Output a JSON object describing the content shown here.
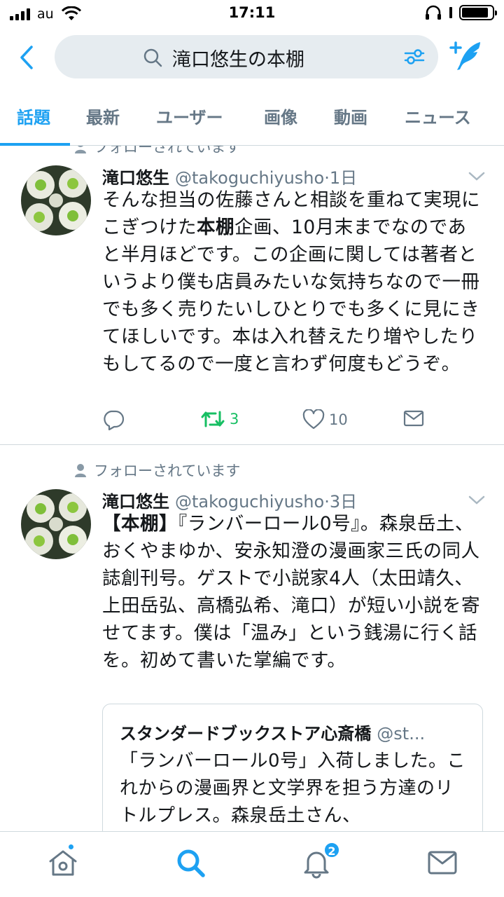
{
  "status_bar": {
    "carrier": "au",
    "time": "17:11"
  },
  "search": {
    "query": "滝口悠生の本棚"
  },
  "tabs": [
    {
      "label": "話題",
      "active": true
    },
    {
      "label": "最新",
      "active": false
    },
    {
      "label": "ユーザー",
      "active": false
    },
    {
      "label": "画像",
      "active": false
    },
    {
      "label": "動画",
      "active": false
    },
    {
      "label": "ニュース",
      "active": false
    }
  ],
  "tweets": [
    {
      "context": "フォローされています",
      "name": "滝口悠生",
      "handle": "@takoguchiyusho",
      "separator": "·",
      "age": "1日",
      "body_before": "そんな担当の佐藤さんと相談を重ねて実現にこぎつけた",
      "body_bold": "本棚",
      "body_after": "企画、10月末までなのであと半月ほどです。この企画に関しては著者というより僕も店員みたいな気持ちなので一冊でも多く売りたいしひとりでも多くに見にきてほしいです。本は入れ替えたり増やしたりもしてるので一度と言わず何度もどうぞ。",
      "retweets": "3",
      "likes": "10"
    },
    {
      "context": "フォローされています",
      "name": "滝口悠生",
      "handle": "@takoguchiyusho",
      "separator": "·",
      "age": "3日",
      "body_bold": "【本棚】",
      "body_after": "『ランバーロール0号』。森泉岳土、おくやまゆか、安永知澄の漫画家三氏の同人誌創刊号。ゲストで小説家4人（太田靖久、上田岳弘、高橋弘希、滝口）が短い小説を寄せてます。僕は「温み」という銭湯に行く話を。初めて書いた掌編です。",
      "quote": {
        "name": "スタンダードブックストア心斎橋",
        "handle": "@st...",
        "body": "「ランバーロール0号」入荷しました。これからの漫画界と文学界を担う方達のリトルプレス。森泉岳土さん、"
      }
    }
  ],
  "tabbar": {
    "notifications_badge": "2"
  },
  "colors": {
    "accent": "#1da1f2",
    "retweet_green": "#17bf63",
    "secondary_text": "#657786",
    "search_bg": "#e6ecf0"
  }
}
